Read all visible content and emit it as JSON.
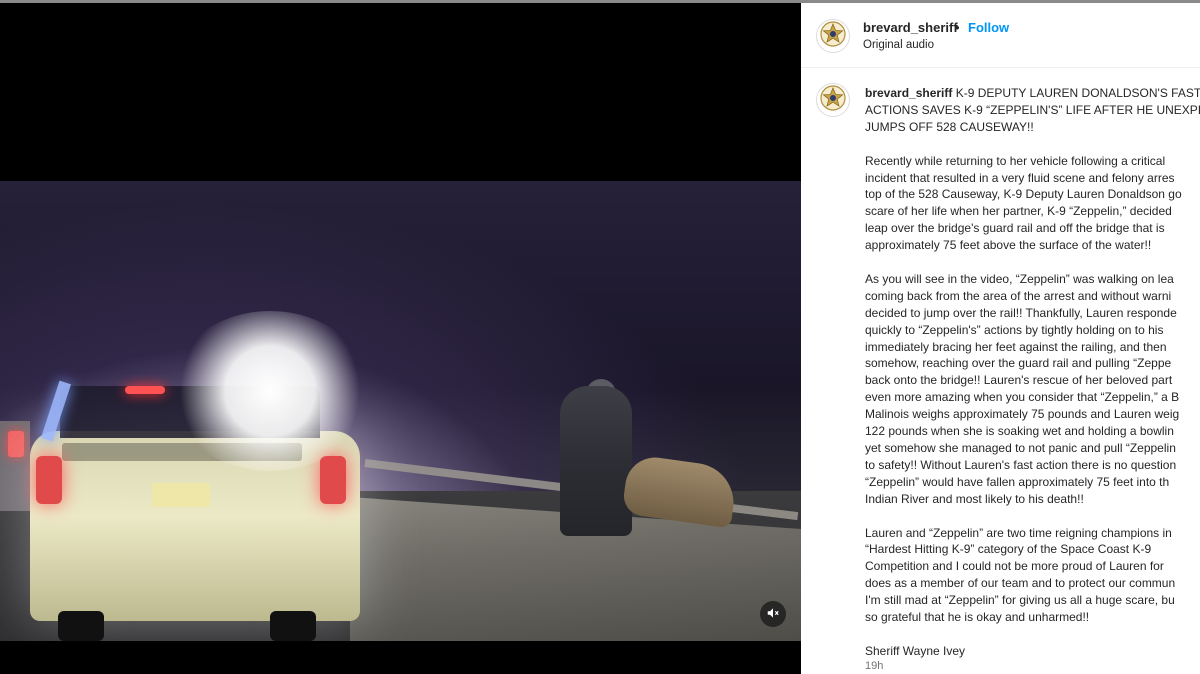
{
  "post": {
    "username": "brevard_sheriff",
    "follow_label": "Follow",
    "separator": "•",
    "audio_label": "Original audio",
    "timestamp": "19h"
  },
  "video": {
    "mute_icon": "speaker-muted-icon"
  },
  "caption": {
    "headline_lines": [
      "K-9 DEPUTY LAUREN DONALDSON'S FAST",
      "ACTIONS SAVES K-9 “ZEPPELIN'S” LIFE AFTER HE UNEXPEC",
      "JUMPS OFF 528 CAUSEWAY!!"
    ],
    "p1": [
      "Recently while returning to her vehicle following a critical",
      "incident that resulted in a very fluid scene and felony arres",
      "top of the 528 Causeway, K-9 Deputy Lauren Donaldson go",
      "scare of her life when her partner, K-9 “Zeppelin,” decided",
      "leap over the bridge's guard rail and off the bridge that is",
      "approximately 75 feet above the surface of the water!!"
    ],
    "p2": [
      "As you will see in the video, “Zeppelin” was walking on lea",
      "coming back from the area of the arrest and without warni",
      "decided to jump over the rail!! Thankfully, Lauren responde",
      "quickly to “Zeppelin's” actions by tightly holding on to his",
      "immediately bracing her feet against the railing, and then",
      "somehow, reaching over the guard rail and pulling “Zeppe",
      "back onto the bridge!! Lauren's rescue of her beloved part",
      "even more amazing when you consider that “Zeppelin,” a B",
      "Malinois weighs approximately 75 pounds and Lauren weig",
      "122 pounds when she is soaking wet and holding a bowlin",
      "yet somehow she managed to not panic and pull “Zeppelin",
      "to safety!! Without Lauren's fast action there is no question",
      "“Zeppelin” would have fallen approximately 75 feet into th",
      "Indian River and most likely to his death!!"
    ],
    "p3": [
      "Lauren and “Zeppelin” are two time reigning champions in",
      "“Hardest Hitting K-9” category of the Space Coast K-9",
      "Competition and I could not be more proud of Lauren for",
      "does as a member of our team and to protect our commun",
      "I'm still mad at “Zeppelin” for giving us all a huge scare, bu",
      "so grateful that he is okay and unharmed!!"
    ],
    "signature": "Sheriff Wayne Ivey"
  }
}
